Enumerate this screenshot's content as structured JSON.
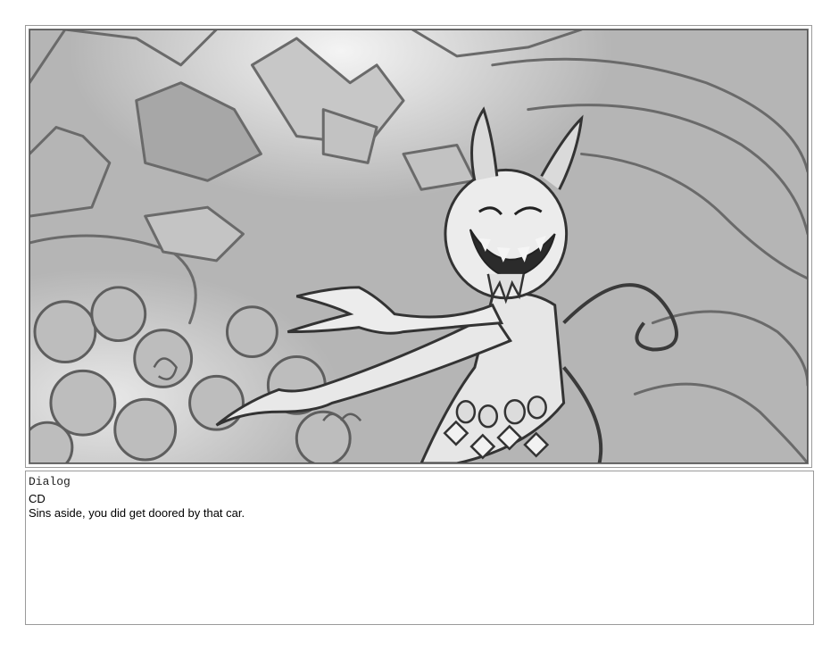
{
  "panel": {
    "image_name": "storyboard-panel-illustration"
  },
  "dialog": {
    "heading": "Dialog",
    "speaker": "CD",
    "line": "Sins aside, you did get doored by that car."
  }
}
